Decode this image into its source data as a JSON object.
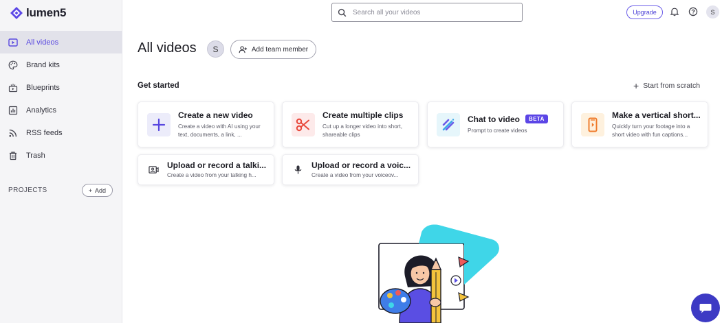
{
  "brand": {
    "name": "lumen5"
  },
  "sidebar": {
    "items": [
      {
        "label": "All videos",
        "icon": "play-square-icon",
        "active": true
      },
      {
        "label": "Brand kits",
        "icon": "palette-icon",
        "active": false
      },
      {
        "label": "Blueprints",
        "icon": "blueprint-icon",
        "active": false
      },
      {
        "label": "Analytics",
        "icon": "bar-chart-icon",
        "active": false
      },
      {
        "label": "RSS feeds",
        "icon": "rss-icon",
        "active": false
      },
      {
        "label": "Trash",
        "icon": "trash-icon",
        "active": false
      }
    ],
    "projects_label": "PROJECTS",
    "add_label": "Add"
  },
  "header": {
    "search_placeholder": "Search all your videos",
    "upgrade_label": "Upgrade",
    "avatar_initial": "S"
  },
  "main": {
    "title": "All videos",
    "avatar_initial": "S",
    "add_team_label": "Add team member",
    "section_title": "Get started",
    "scratch_label": "Start from scratch",
    "cards": [
      {
        "title": "Create a new video",
        "desc": "Create a video with AI using your text, documents, a link, ...",
        "icon": "plus-icon"
      },
      {
        "title": "Create multiple clips",
        "desc": "Cut up a longer video into short, shareable clips",
        "icon": "scissors-icon"
      },
      {
        "title": "Chat to video",
        "badge": "BETA",
        "desc": "Prompt to create videos",
        "icon": "magic-wand-icon"
      },
      {
        "title": "Make a vertical short...",
        "desc": "Quickly turn your footage into a short video with fun captions...",
        "icon": "vertical-phone-icon"
      }
    ],
    "small_cards": [
      {
        "title": "Upload or record a talki...",
        "desc": "Create a video from your talking h...",
        "icon": "camera-icon"
      },
      {
        "title": "Upload or record a voic...",
        "desc": "Create a video from your voiceov...",
        "icon": "microphone-icon"
      }
    ]
  },
  "colors": {
    "accent": "#5847e0",
    "chat": "#3d3ac4",
    "cyan": "#3fd6e8"
  }
}
